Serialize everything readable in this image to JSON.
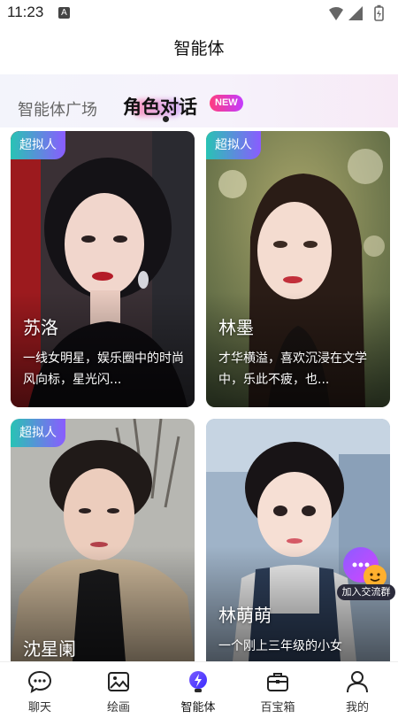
{
  "status_bar": {
    "time": "11:23",
    "notification_letter": "A"
  },
  "header": {
    "title": "智能体"
  },
  "tabs": {
    "items": [
      {
        "label": "智能体广场",
        "active": false
      },
      {
        "label": "角色对话",
        "active": true
      }
    ],
    "new_badge": "NEW"
  },
  "cards": [
    {
      "badge": "超拟人",
      "name": "苏洛",
      "desc": "一线女明星，娱乐圈中的时尚风向标，星光闪..."
    },
    {
      "badge": "超拟人",
      "name": "林墨",
      "desc": "才华横溢，喜欢沉浸在文学中，乐此不疲，也..."
    },
    {
      "badge": "超拟人",
      "name": "沈星阑",
      "desc": ""
    },
    {
      "badge": "",
      "name": "林萌萌",
      "desc": "一个刚上三年级的小女"
    }
  ],
  "join_group": {
    "label": "加入交流群"
  },
  "bottom_nav": [
    {
      "label": "聊天",
      "icon": "chat-icon"
    },
    {
      "label": "绘画",
      "icon": "picture-icon"
    },
    {
      "label": "智能体",
      "icon": "agent-bulb-icon",
      "active": true
    },
    {
      "label": "百宝箱",
      "icon": "toolbox-icon"
    },
    {
      "label": "我的",
      "icon": "profile-icon"
    }
  ],
  "colors": {
    "accent_gradient_start": "#28c3b4",
    "accent_gradient_end": "#8a5cff",
    "new_badge_start": "#ff3d7f",
    "new_badge_end": "#c33cff",
    "active_nav": "#5a3cff"
  }
}
